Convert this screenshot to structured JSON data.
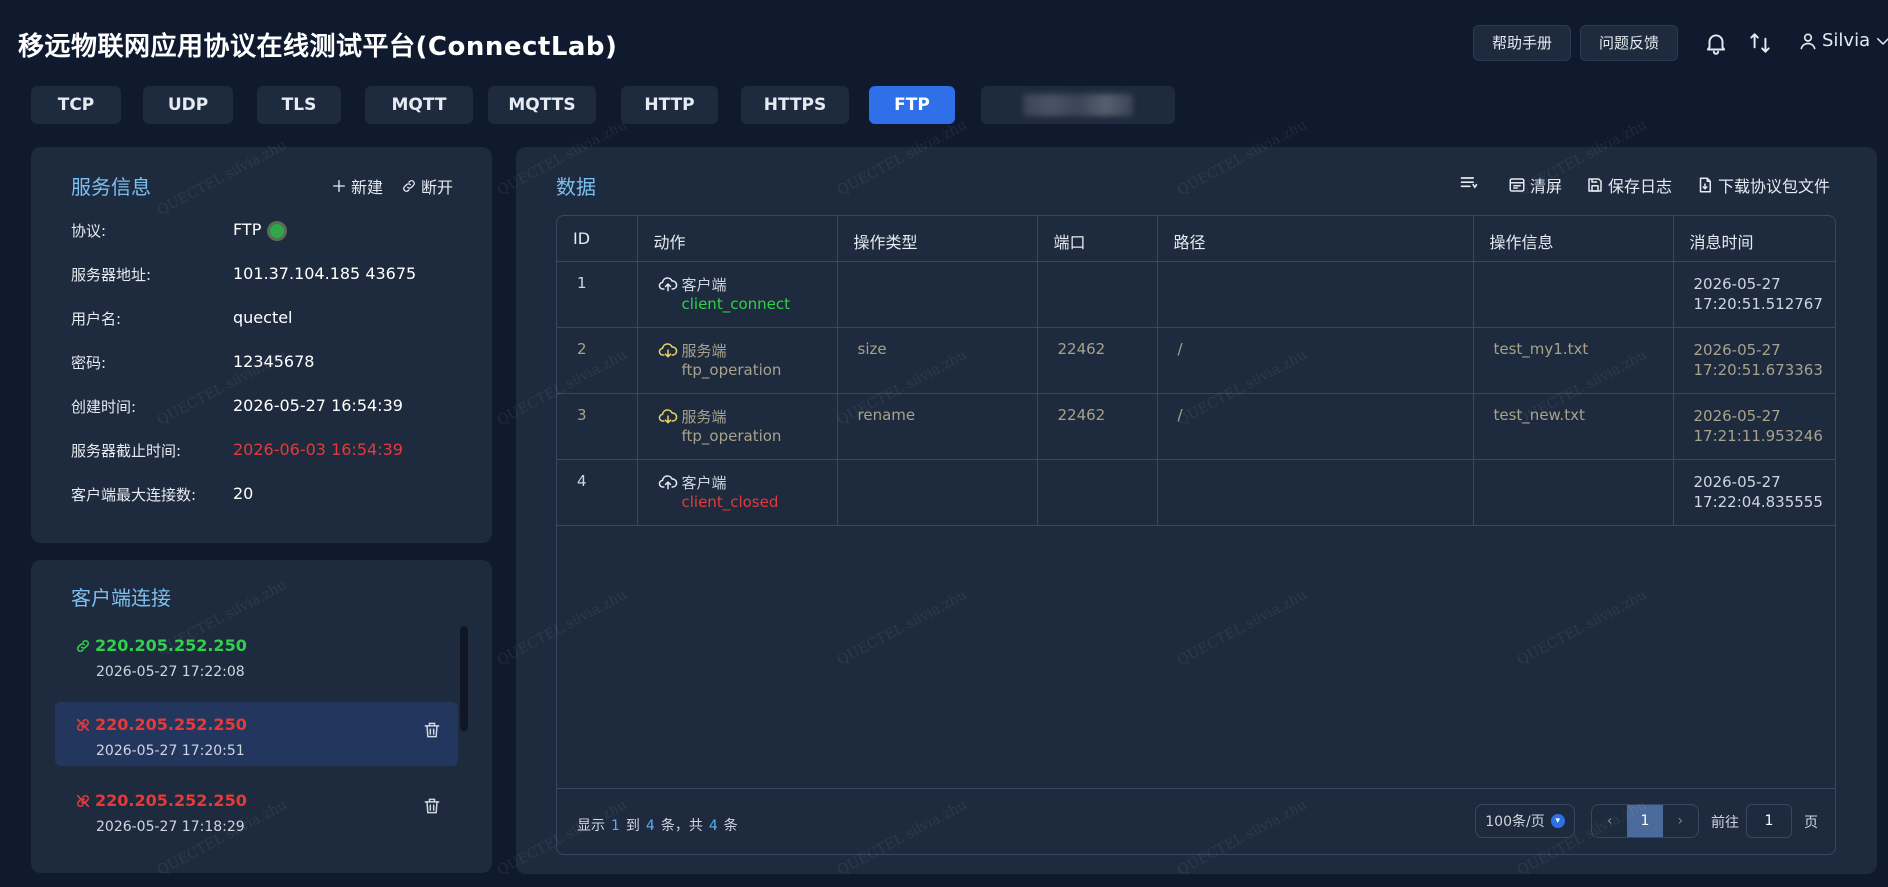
{
  "header": {
    "title": "移远物联网应用协议在线测试平台(ConnectLab)",
    "help_label": "帮助手册",
    "feedback_label": "问题反馈",
    "icons": [
      "bell-icon",
      "swap-icon",
      "user-icon",
      "chevron-down-icon"
    ],
    "user_name": "Silvia"
  },
  "tabs": [
    {
      "label": "TCP"
    },
    {
      "label": "UDP"
    },
    {
      "label": "TLS"
    },
    {
      "label": "MQTT"
    },
    {
      "label": "MQTTS"
    },
    {
      "label": "HTTP"
    },
    {
      "label": "HTTPS"
    },
    {
      "label": "FTP",
      "active": true
    }
  ],
  "service_info": {
    "title": "服务信息",
    "new_label": "新建",
    "disconnect_label": "断开",
    "rows": [
      {
        "label": "协议:",
        "value": "FTP"
      },
      {
        "label": "服务器地址:",
        "value": "101.37.104.185 43675"
      },
      {
        "label": "用户名:",
        "value": "quectel"
      },
      {
        "label": "密码:",
        "value": "12345678"
      },
      {
        "label": "创建时间:",
        "value": "2026-05-27 16:54:39"
      },
      {
        "label": "服务器截止时间:",
        "value": "2026-06-03 16:54:39"
      },
      {
        "label": "客户端最大连接数:",
        "value": "20"
      }
    ],
    "status_color": "#2ea84a"
  },
  "client_connections": {
    "title": "客户端连接",
    "items": [
      {
        "ip": "220.205.252.250",
        "time": "2026-05-27 17:22:08",
        "state": "connected"
      },
      {
        "ip": "220.205.252.250",
        "time": "2026-05-27 17:20:51",
        "state": "closed"
      },
      {
        "ip": "220.205.252.250",
        "time": "2026-05-27 17:18:29",
        "state": "closed"
      }
    ]
  },
  "data_panel": {
    "title": "数据",
    "clear_label": "清屏",
    "save_log_label": "保存日志",
    "download_label": "下载协议包文件",
    "columns": [
      "ID",
      "动作",
      "操作类型",
      "端口",
      "路径",
      "操作信息",
      "消息时间"
    ],
    "rows": [
      {
        "id": "1",
        "role": "客户端",
        "event": "client_connect",
        "op_type": "",
        "port": "",
        "path": "",
        "info": "",
        "date": "2026-05-27",
        "time": "17:20:51.512767"
      },
      {
        "id": "2",
        "role": "服务端",
        "event": "ftp_operation",
        "op_type": "size",
        "port": "22462",
        "path": "/",
        "info": "test_my1.txt",
        "date": "2026-05-27",
        "time": "17:20:51.673363"
      },
      {
        "id": "3",
        "role": "服务端",
        "event": "ftp_operation",
        "op_type": "rename",
        "port": "22462",
        "path": "/",
        "info": "test_new.txt",
        "date": "2026-05-27",
        "time": "17:21:11.953246"
      },
      {
        "id": "4",
        "role": "客户端",
        "event": "client_closed",
        "op_type": "",
        "port": "",
        "path": "",
        "info": "",
        "date": "2026-05-27",
        "time": "17:22:04.835555"
      }
    ],
    "pager": {
      "show": "显示",
      "from": "1",
      "to_word": "到",
      "to": "4",
      "items_total_word": "条，共",
      "total": "4",
      "items_word": "条",
      "page_size": "100条/页",
      "current_page": "1",
      "goto_prefix": "前往",
      "goto_value": "1",
      "goto_suffix": "页"
    }
  },
  "watermark": "QUECTEL silvia.zhu",
  "colors": {
    "accent": "#2f6fe8",
    "success": "#2fd14b",
    "danger": "#e43a3a",
    "title_blue": "#7cc0f0"
  }
}
